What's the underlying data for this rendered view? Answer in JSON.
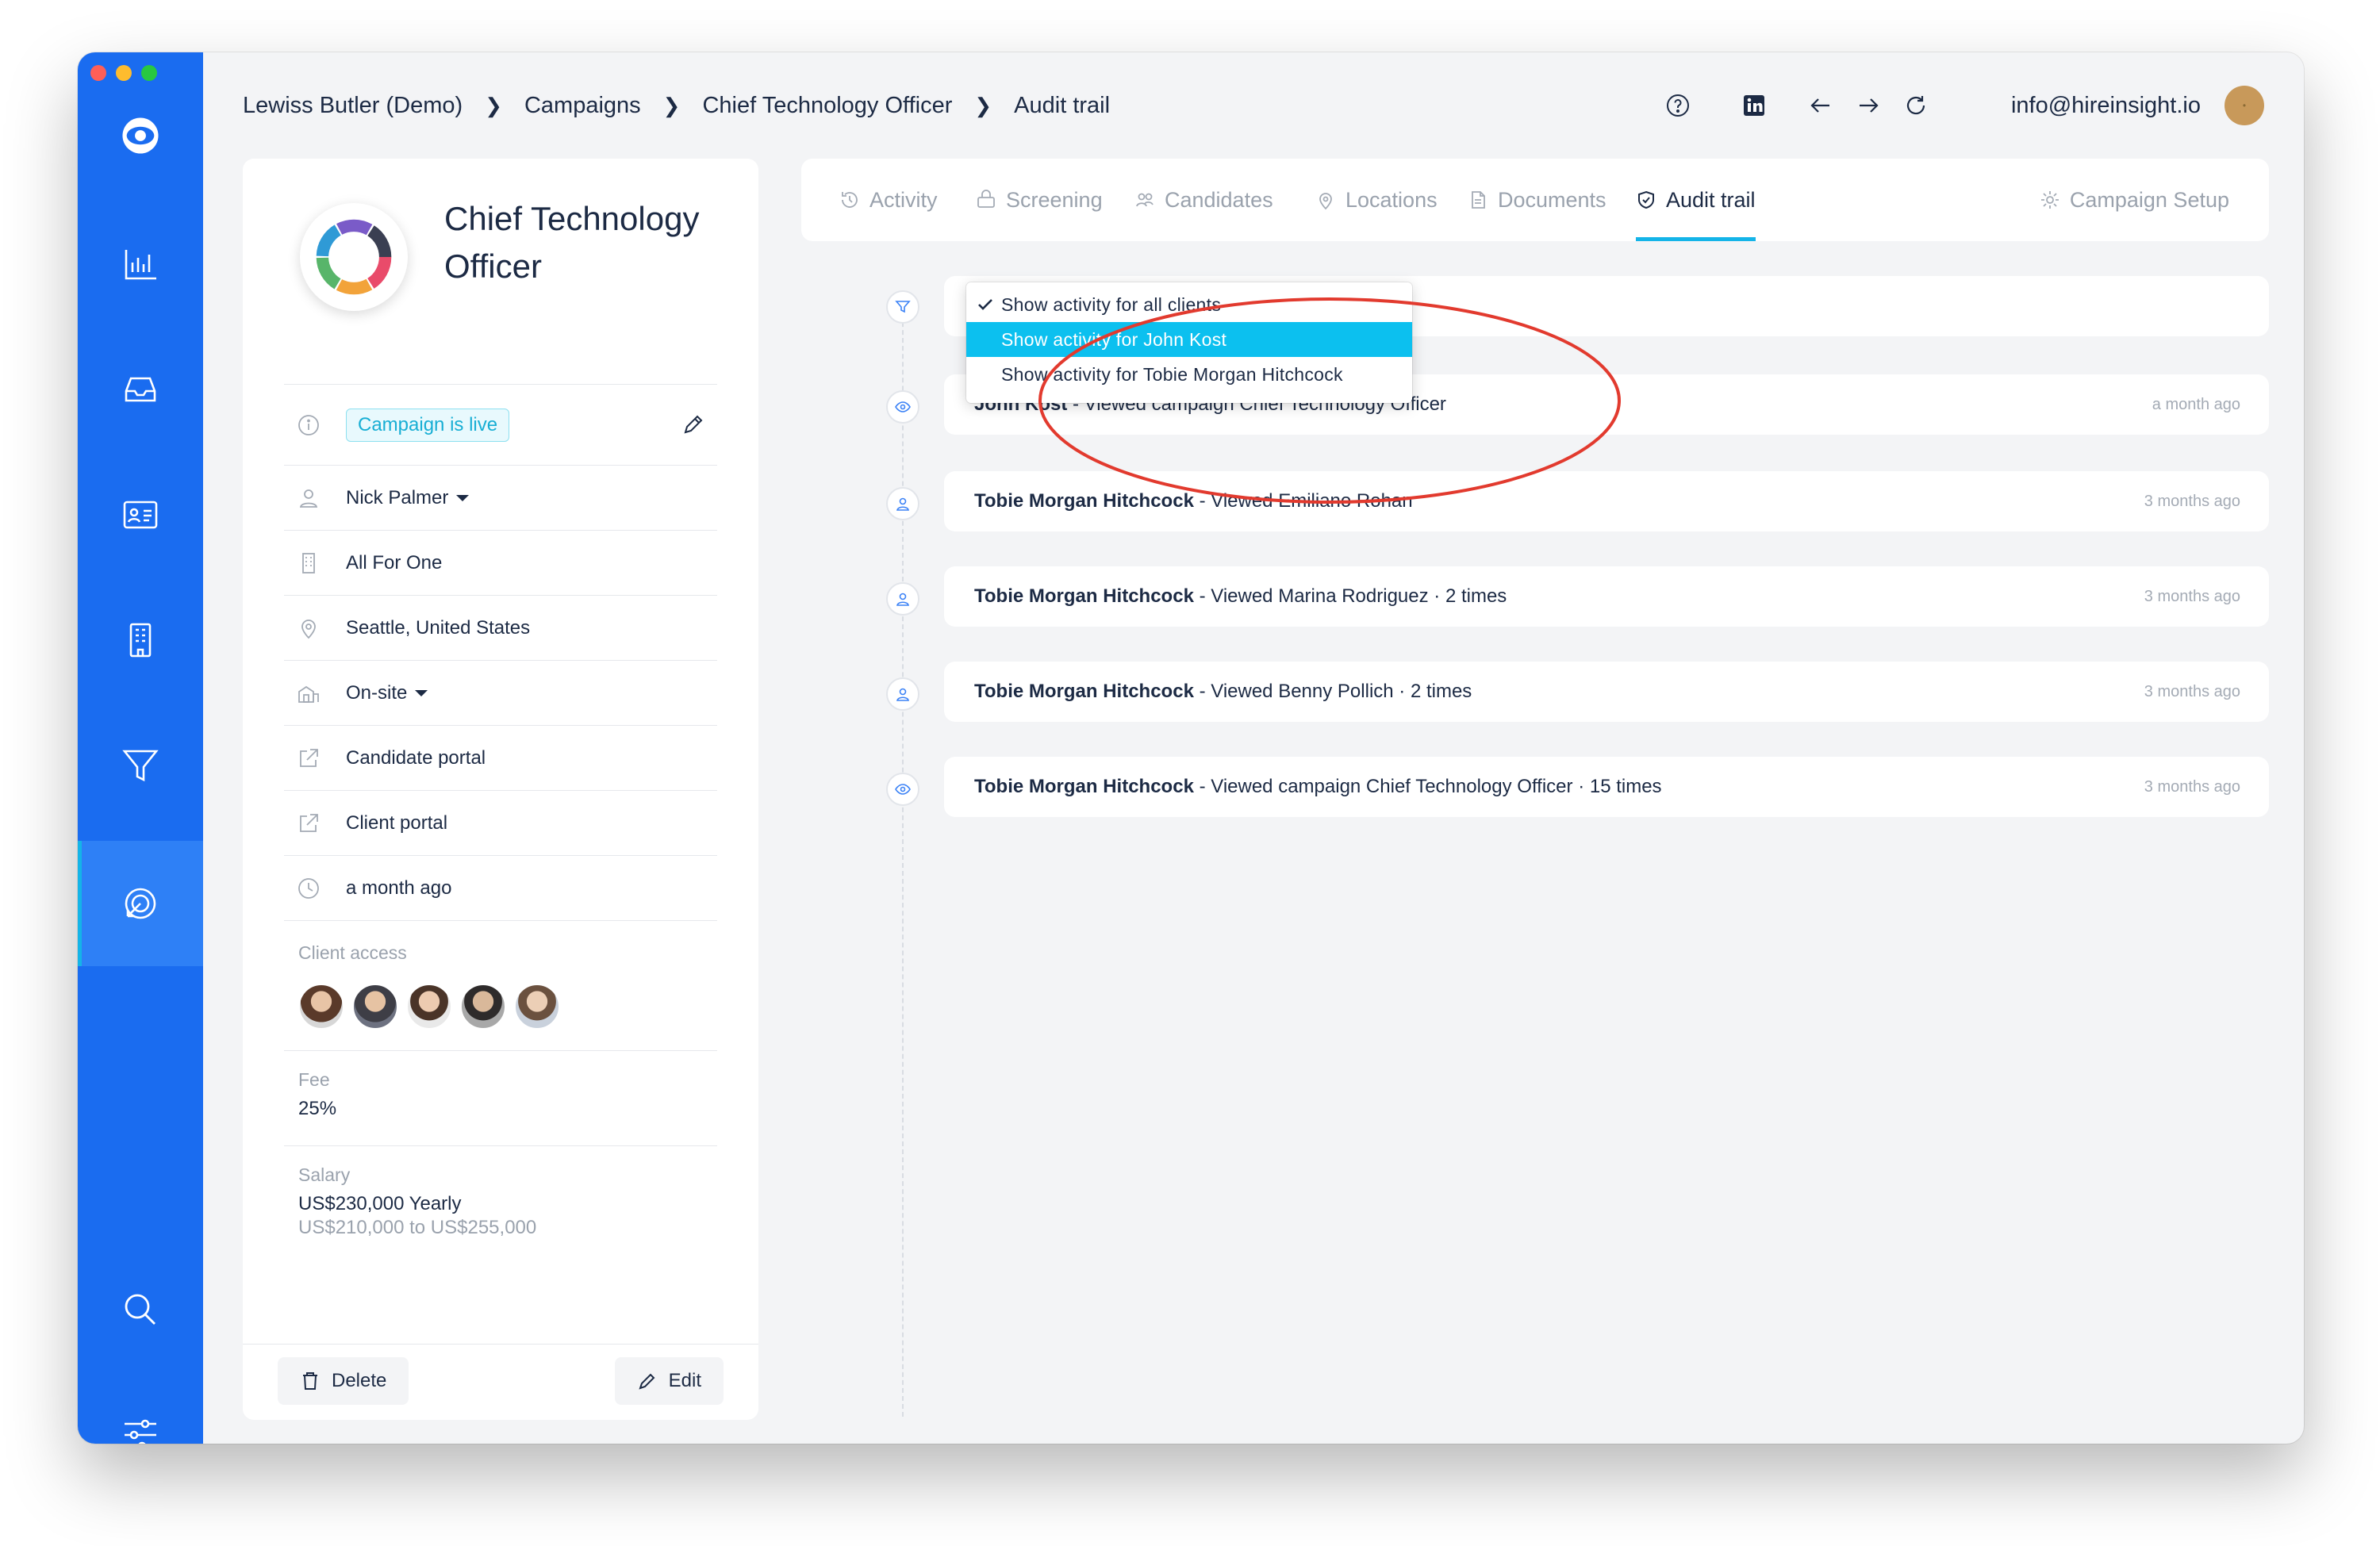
{
  "breadcrumb": [
    "Lewiss Butler (Demo)",
    "Campaigns",
    "Chief Technology Officer",
    "Audit trail"
  ],
  "header": {
    "email": "info@hireinsight.io"
  },
  "campaign": {
    "title": "Chief Technology Officer",
    "status_badge": "Campaign is live",
    "owner": "Nick Palmer",
    "company": "All For One",
    "location": "Seattle, United States",
    "work_mode": "On-site",
    "candidate_portal": "Candidate portal",
    "client_portal": "Client portal",
    "created": "a month ago",
    "client_access_label": "Client access",
    "fee_label": "Fee",
    "fee_value": "25%",
    "salary_label": "Salary",
    "salary_value": "US$230,000 Yearly",
    "salary_range": "US$210,000 to US$255,000",
    "delete_label": "Delete",
    "edit_label": "Edit"
  },
  "tabs": [
    {
      "label": "Activity",
      "icon": "history-icon"
    },
    {
      "label": "Screening",
      "icon": "screening-icon"
    },
    {
      "label": "Candidates",
      "icon": "users-icon"
    },
    {
      "label": "Locations",
      "icon": "location-pin-icon"
    },
    {
      "label": "Documents",
      "icon": "document-icon"
    },
    {
      "label": "Audit trail",
      "icon": "shield-icon",
      "active": true
    },
    {
      "label": "Campaign Setup",
      "icon": "gear-icon"
    }
  ],
  "filter_menu": {
    "options": [
      "Show activity for all clients",
      "Show activity for John Kost",
      "Show activity for Tobie Morgan Hitchcock"
    ],
    "checked_index": 0,
    "highlighted_index": 1
  },
  "events": [
    {
      "actor": "John Kost",
      "action": "Viewed campaign Chief Technology Officer",
      "time": "a month ago",
      "icon": "eye-icon"
    },
    {
      "actor": "Tobie Morgan Hitchcock",
      "action": "Viewed Emiliano Rohan",
      "time": "3 months ago",
      "icon": "user-icon"
    },
    {
      "actor": "Tobie Morgan Hitchcock",
      "action": "Viewed Marina Rodriguez · 2 times",
      "time": "3 months ago",
      "icon": "user-icon"
    },
    {
      "actor": "Tobie Morgan Hitchcock",
      "action": "Viewed Benny Pollich · 2 times",
      "time": "3 months ago",
      "icon": "user-icon"
    },
    {
      "actor": "Tobie Morgan Hitchcock",
      "action": "Viewed campaign Chief Technology Officer · 15 times",
      "time": "3 months ago",
      "icon": "eye-icon"
    }
  ],
  "event_separator": " - ",
  "colors": {
    "sidebar": "#1a6cf0",
    "accent": "#14b4e8",
    "highlight": "#0cc0ef",
    "annotation": "#e23a2e"
  }
}
